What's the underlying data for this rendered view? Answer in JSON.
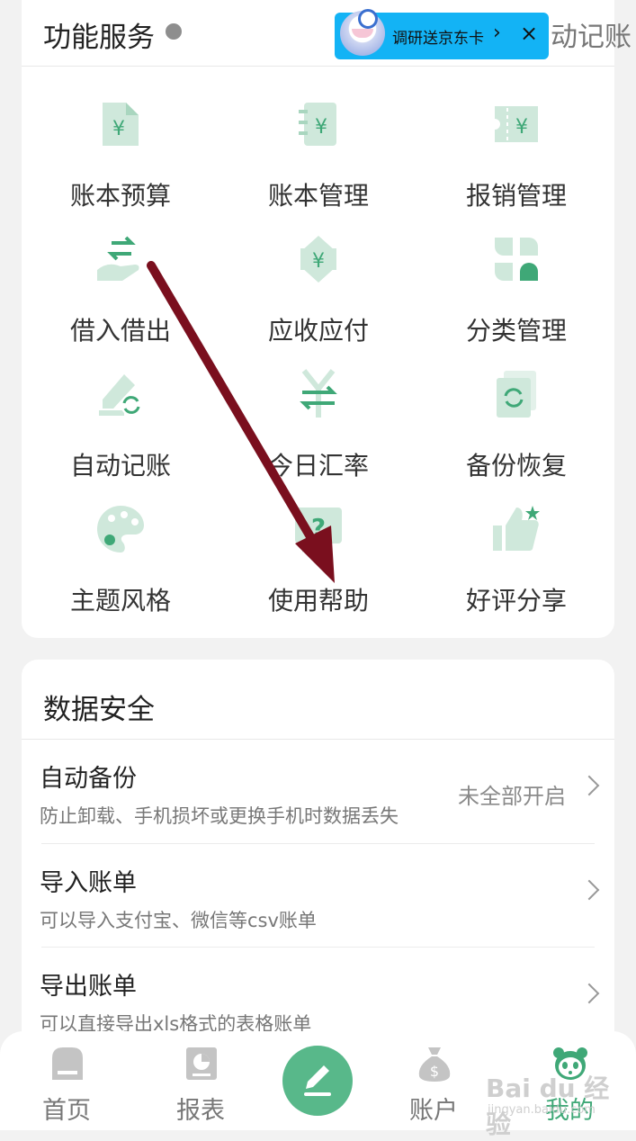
{
  "services": {
    "title": "功能服务",
    "auto_partial": "动记账",
    "promo": {
      "text": "调研送京东卡",
      "chevron": "›",
      "close": "×"
    },
    "items": [
      {
        "label": "账本预算",
        "icon": "ledger-budget-icon"
      },
      {
        "label": "账本管理",
        "icon": "ledger-manage-icon"
      },
      {
        "label": "报销管理",
        "icon": "reimburse-icon"
      },
      {
        "label": "借入借出",
        "icon": "lend-borrow-icon"
      },
      {
        "label": "应收应付",
        "icon": "receivable-icon"
      },
      {
        "label": "分类管理",
        "icon": "category-icon"
      },
      {
        "label": "自动记账",
        "icon": "auto-record-icon"
      },
      {
        "label": "今日汇率",
        "icon": "exchange-rate-icon"
      },
      {
        "label": "备份恢复",
        "icon": "backup-restore-icon"
      },
      {
        "label": "主题风格",
        "icon": "palette-icon"
      },
      {
        "label": "使用帮助",
        "icon": "help-icon"
      },
      {
        "label": "好评分享",
        "icon": "thumbs-up-icon"
      }
    ]
  },
  "security": {
    "title": "数据安全",
    "rows": [
      {
        "title": "自动备份",
        "desc": "防止卸载、手机损坏或更换手机时数据丢失",
        "status": "未全部开启"
      },
      {
        "title": "导入账单",
        "desc": "可以导入支付宝、微信等csv账单",
        "status": ""
      },
      {
        "title": "导出账单",
        "desc": "可以直接导出xls格式的表格账单",
        "status": ""
      }
    ]
  },
  "nav": {
    "items": [
      {
        "label": "首页",
        "icon": "home-icon"
      },
      {
        "label": "报表",
        "icon": "report-icon"
      },
      {
        "label": "",
        "icon": "pencil-icon"
      },
      {
        "label": "账户",
        "icon": "money-bag-icon"
      },
      {
        "label": "我的",
        "icon": "panda-icon"
      }
    ],
    "active": "我的"
  },
  "colors": {
    "accent": "#58b88a",
    "icon_light": "#cfe8db",
    "icon_dark": "#5aa987",
    "arrow": "#7a0f1e"
  },
  "watermark": {
    "main": "Bai du 经验",
    "sub": "jingyan.baidu.com"
  }
}
